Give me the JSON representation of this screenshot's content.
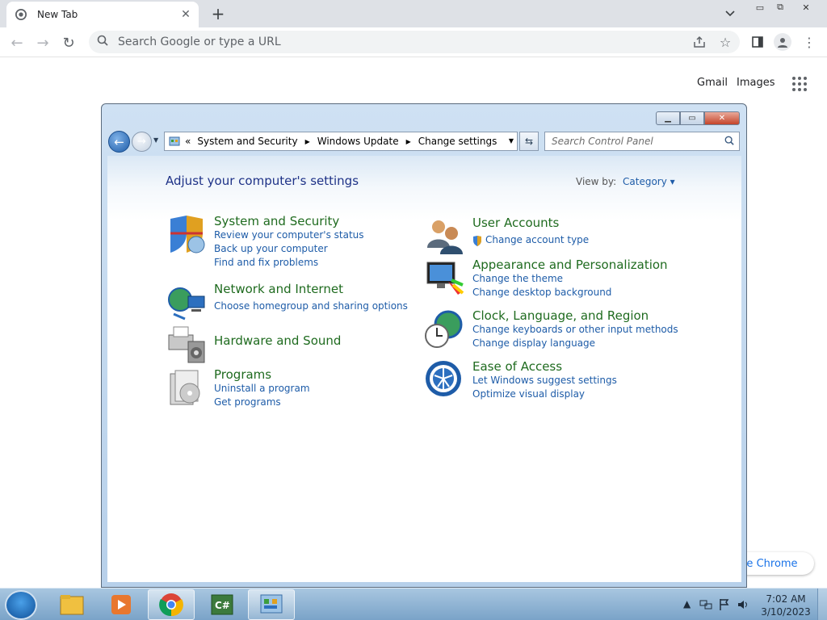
{
  "browser": {
    "tab_title": "New Tab",
    "new_tab_icon": "+",
    "omnibox_placeholder": "Search Google or type a URL",
    "links": {
      "gmail": "Gmail",
      "images": "Images"
    },
    "customize_label": "ize Chrome"
  },
  "window": {
    "breadcrumb": [
      "System and Security",
      "Windows Update",
      "Change settings"
    ],
    "breadcrumb_prefix": "«",
    "search_placeholder": "Search Control Panel"
  },
  "panel": {
    "heading": "Adjust your computer's settings",
    "view_by_label": "View by:",
    "view_by_value": "Category",
    "left": [
      {
        "title": "System and Security",
        "links": [
          "Review your computer's status",
          "Back up your computer",
          "Find and fix problems"
        ],
        "icon": "shield-icon"
      },
      {
        "title": "Network and Internet",
        "links": [
          "Choose homegroup and sharing options"
        ],
        "icon": "network-globe-icon"
      },
      {
        "title": "Hardware and Sound",
        "links": [],
        "icon": "printer-speaker-icon"
      },
      {
        "title": "Programs",
        "links": [
          "Uninstall a program",
          "Get programs"
        ],
        "icon": "programs-disc-icon"
      }
    ],
    "right": [
      {
        "title": "User Accounts",
        "links": [
          "Change account type"
        ],
        "icon": "users-icon"
      },
      {
        "title": "Appearance and Personalization",
        "links": [
          "Change the theme",
          "Change desktop background"
        ],
        "icon": "monitor-palette-icon"
      },
      {
        "title": "Clock, Language, and Region",
        "links": [
          "Change keyboards or other input methods",
          "Change display language"
        ],
        "icon": "clock-globe-icon"
      },
      {
        "title": "Ease of Access",
        "links": [
          "Let Windows suggest settings",
          "Optimize visual display"
        ],
        "icon": "ease-of-access-icon"
      }
    ]
  },
  "taskbar": {
    "time": "7:02 AM",
    "date": "3/10/2023",
    "apps": [
      "file-explorer-icon",
      "media-player-icon",
      "chrome-icon",
      "csharp-ide-icon",
      "control-panel-icon"
    ]
  }
}
